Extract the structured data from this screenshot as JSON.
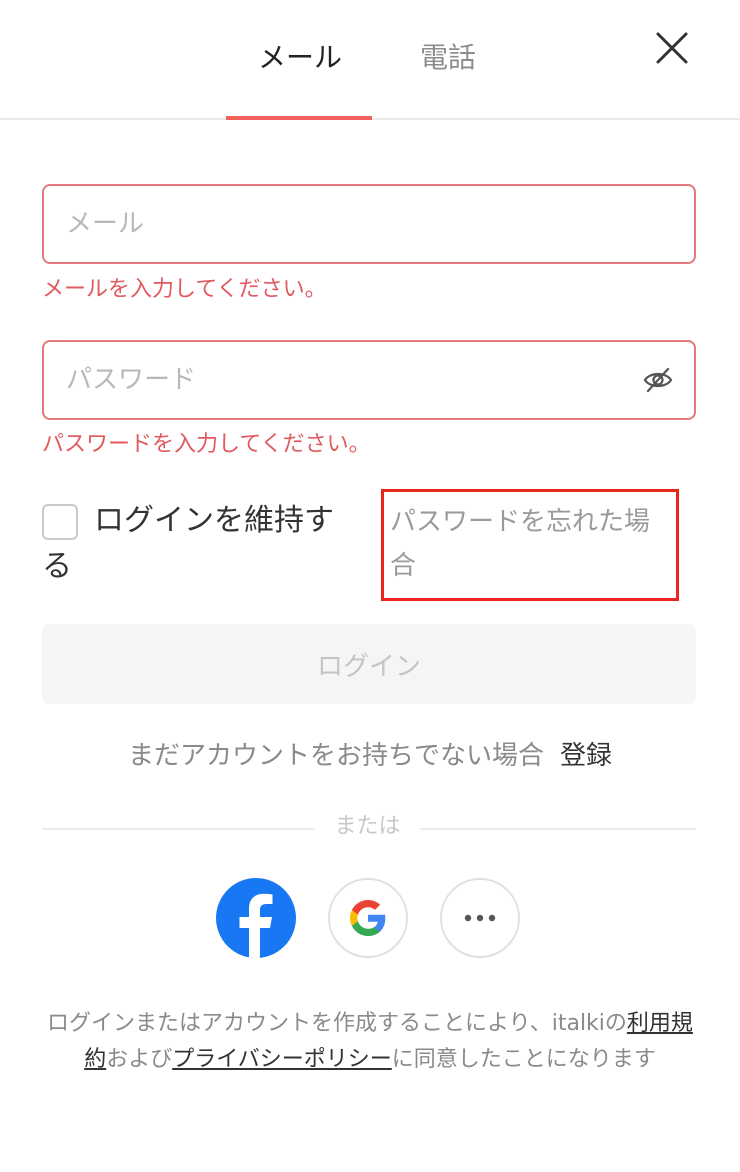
{
  "tabs": {
    "email_label": "メール",
    "phone_label": "電話",
    "active": "email"
  },
  "icons": {
    "close": "close-icon",
    "eye": "eye-off-icon",
    "facebook": "facebook-icon",
    "google": "google-icon",
    "more": "more-icon"
  },
  "colors": {
    "accent": "#f0625b",
    "error": "#e05a5f",
    "highlight_box": "#e8261c",
    "facebook": "#1877f2"
  },
  "form": {
    "email_placeholder": "メール",
    "email_value": "",
    "email_error": "メールを入力してください。",
    "password_placeholder": "パスワード",
    "password_value": "",
    "password_error": "パスワードを入力してください。",
    "remember_label": "ログインを維持する",
    "remember_checked": false,
    "forgot_label": "パスワードを忘れた場合",
    "login_button": "ログイン"
  },
  "signup": {
    "prompt": "まだアカウントをお持ちでない場合",
    "link": "登録"
  },
  "divider": {
    "label": "または"
  },
  "legal": {
    "text_1": "ログインまたはアカウントを作成することにより、italkiの",
    "terms_link": "利用規約",
    "text_2": "および",
    "privacy_link": "プライバシーポリシー",
    "text_3": "に同意したことになります"
  }
}
